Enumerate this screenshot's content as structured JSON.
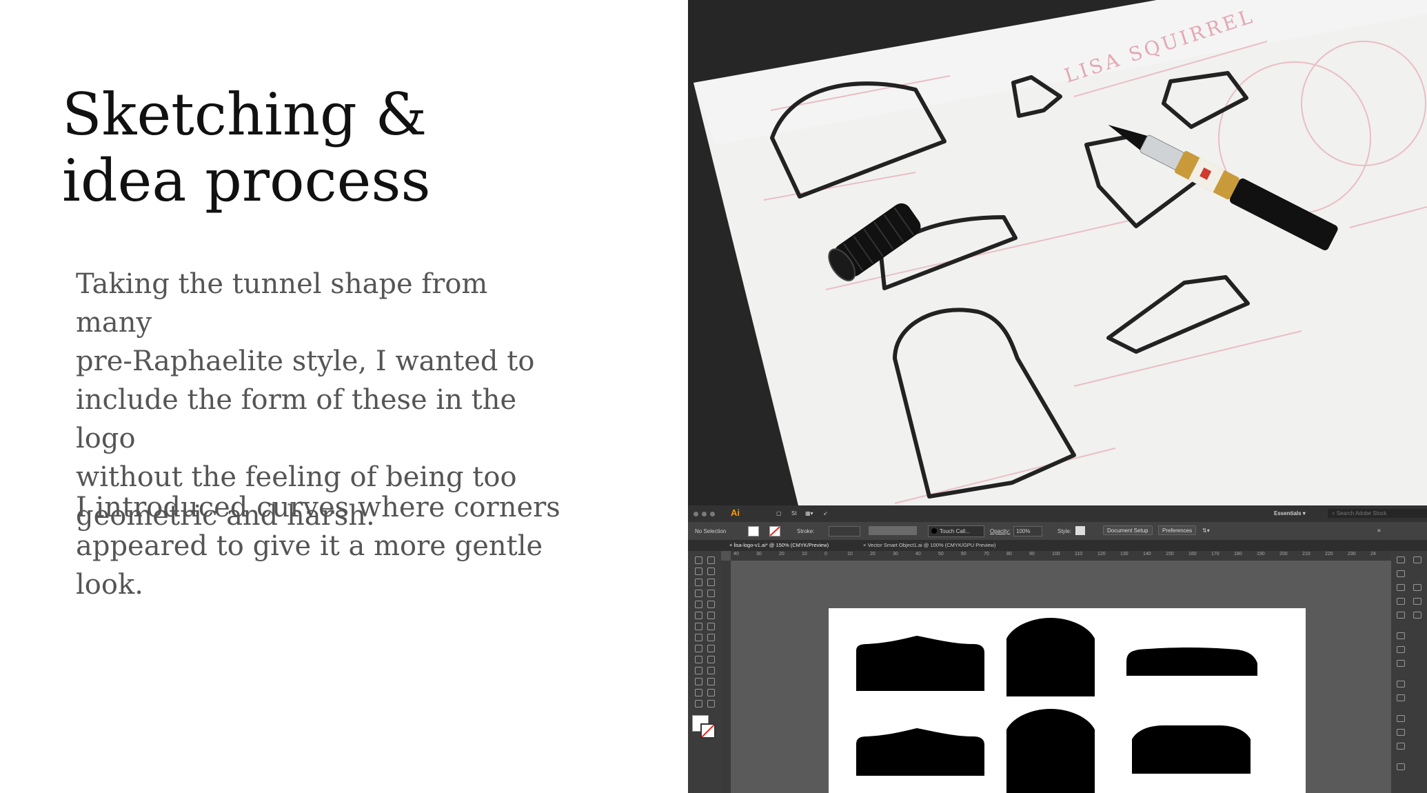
{
  "slide": {
    "title_line1": "Sketching &",
    "title_line2": "idea process",
    "paragraph1_lines": [
      "Taking the tunnel shape from many",
      "pre-Raphaelite style, I wanted to",
      "include the form of these in the logo",
      "without the feeling of being too",
      "geometric and harsh."
    ],
    "paragraph2_lines": [
      "I introduced  curves where corners",
      "appeared to give it a more gentle look."
    ]
  },
  "photo": {
    "paper_text": "LISA SQUIRREL"
  },
  "illustrator": {
    "app_logo": "Ai",
    "workspace": "Essentials",
    "search_placeholder": "Search Adobe Stock",
    "control_bar": {
      "selection": "No Selection",
      "stroke_label": "Stroke:",
      "brush": "Touch Call...",
      "opacity_label": "Opacity:",
      "opacity_value": "100%",
      "style_label": "Style:",
      "document_setup": "Document Setup",
      "preferences": "Preferences"
    },
    "tabs": [
      "lisa-logo-v1.ai* @ 150% (CMYK/Preview)",
      "Vector Smart Object1.ai @ 100% (CMYK/GPU Preview)"
    ],
    "ruler_ticks": [
      "40",
      "30",
      "20",
      "10",
      "0",
      "10",
      "20",
      "30",
      "40",
      "50",
      "60",
      "70",
      "80",
      "90",
      "100",
      "110",
      "120",
      "130",
      "140",
      "150",
      "160",
      "170",
      "180",
      "190",
      "200",
      "210",
      "220",
      "230",
      "24"
    ],
    "accent_color": "#ff9a00"
  }
}
